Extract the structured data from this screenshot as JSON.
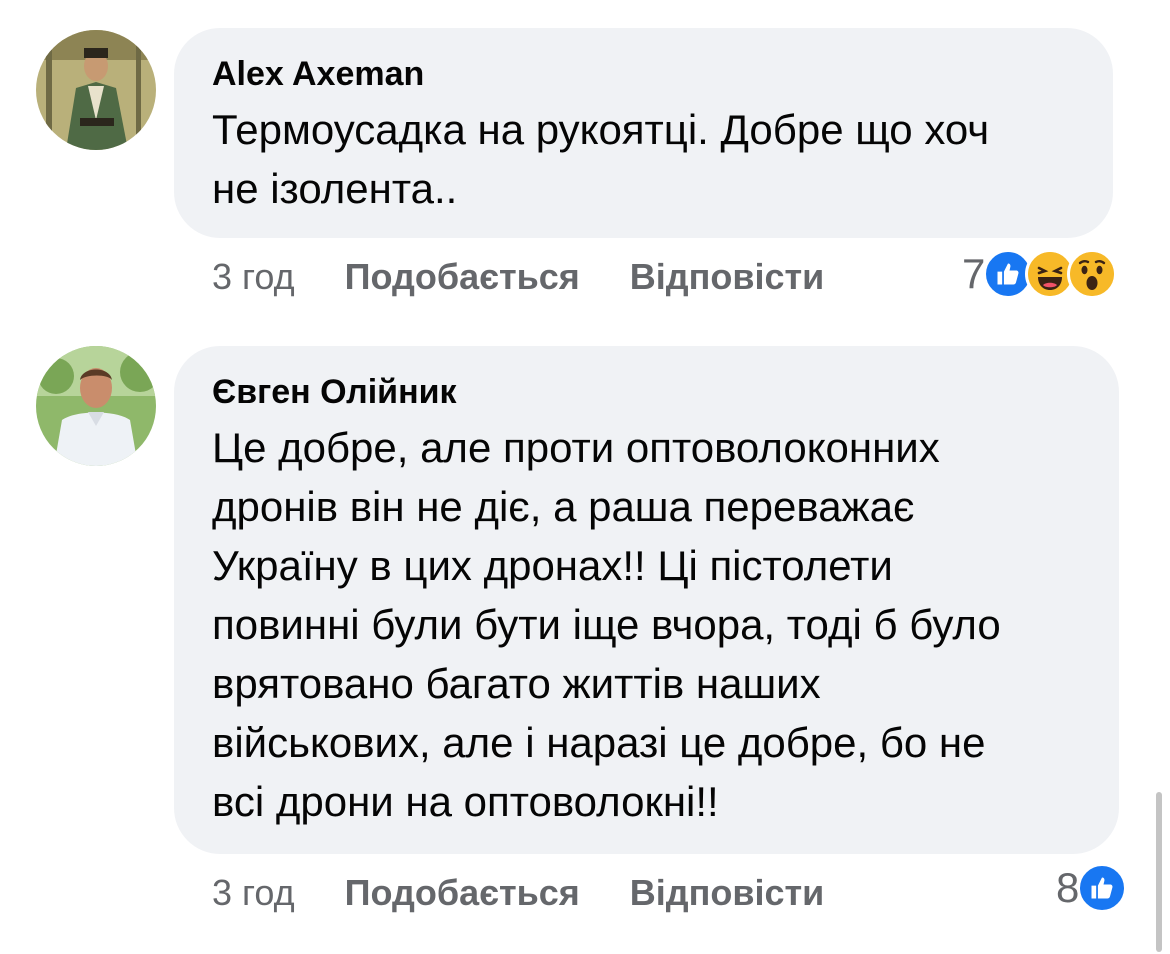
{
  "comments": [
    {
      "author": "Alex Axeman",
      "text_lines": [
        "Термоусадка на рукоятці. Добре що хоч",
        "не ізолента.."
      ],
      "time": "3 год",
      "like_label": "Подобається",
      "reply_label": "Відповісти",
      "reaction_count": "7",
      "reactions": [
        "like-icon",
        "haha-icon",
        "wow-icon"
      ]
    },
    {
      "author": "Євген Олійник",
      "text_lines": [
        "Це добре, але проти оптоволоконних",
        "дронів він не діє, а раша переважає",
        "Україну в цих дронах!! Ці пістолети",
        "повинні були бути іще вчора, тоді б було",
        "врятовано багато життів наших",
        "військових, але і наразі це добре, бо не",
        "всі дрони на оптоволокні!!"
      ],
      "time": "3 год",
      "like_label": "Подобається",
      "reply_label": "Відповісти",
      "reaction_count": "8",
      "reactions": [
        "like-icon"
      ]
    }
  ],
  "colors": {
    "bubble": "#f0f2f5",
    "secondary_text": "#65676b",
    "like_blue": "#1877f2",
    "emoji_yellow": "#f7b928"
  }
}
